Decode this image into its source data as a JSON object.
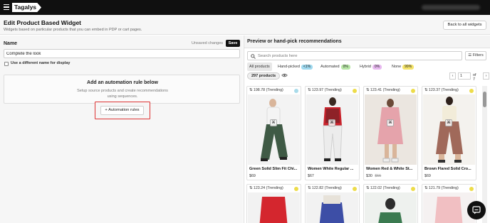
{
  "topbar": {
    "logo": "Tagalys"
  },
  "page": {
    "title": "Edit Product Based Widget",
    "subtitle": "Widgets based on particular products that you can embed in PDP or cart pages.",
    "back_label": "Back to all widgets"
  },
  "form": {
    "name_label": "Name",
    "unsaved": "Unsaved changes",
    "save_label": "Save",
    "name_value": "Complete the look",
    "checkbox_label": "Use a different name for display",
    "automation_title": "Add an automation rule below",
    "automation_subtitle": "Setup source products and create recommendations using sequences.",
    "automation_button": "+ Automation rules"
  },
  "preview": {
    "title": "Preview or hand-pick recommendations",
    "search_placeholder": "Search products here",
    "filters_label": "Filters",
    "tabs": [
      {
        "label": "All products",
        "badge": ""
      },
      {
        "label": "Hand-picked",
        "badge": "<1%",
        "color": "#9fd9ef"
      },
      {
        "label": "Automated",
        "badge": "0%",
        "color": "#b7e6a6"
      },
      {
        "label": "Hybrid",
        "badge": "0%",
        "color": "#e7b8ef"
      },
      {
        "label": "None",
        "badge": "99%",
        "color": "#f4e36a"
      }
    ],
    "count": "297 products",
    "page_current": "1",
    "page_of": "of 7"
  },
  "products": [
    {
      "score": "⇅ 198.78 (Trending)",
      "name": "Green Solid Slim Fit Chi...",
      "price": "$69",
      "old_price": "",
      "dot": "#a9dbea"
    },
    {
      "score": "⇅ 123.97 (Trending)",
      "name": "Women White Regular ...",
      "price": "$67",
      "old_price": "",
      "dot": "#eddc4a"
    },
    {
      "score": "⇅ 123.41 (Trending)",
      "name": "Women Red & White St...",
      "price": "$30",
      "old_price": "$55",
      "dot": "#eddc4a"
    },
    {
      "score": "⇅ 123.37 (Trending)",
      "name": "Brown Flared Solid Cro...",
      "price": "$69",
      "old_price": "",
      "dot": "#eddc4a"
    },
    {
      "score": "⇅ 123.24 (Trending)",
      "name": "",
      "price": "",
      "old_price": "",
      "dot": "#eddc4a"
    },
    {
      "score": "⇅ 122.82 (Trending)",
      "name": "",
      "price": "",
      "old_price": "",
      "dot": "#eddc4a"
    },
    {
      "score": "⇅ 122.02 (Trending)",
      "name": "",
      "price": "",
      "old_price": "",
      "dot": "#eddc4a"
    },
    {
      "score": "⇅ 121.79 (Trending)",
      "name": "",
      "price": "",
      "old_price": "",
      "dot": "#eddc4a"
    }
  ]
}
